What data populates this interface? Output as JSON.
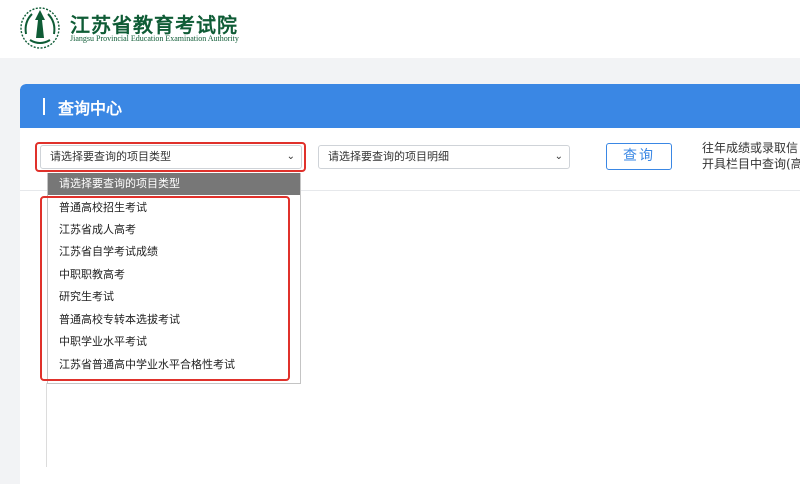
{
  "header": {
    "org_cn": "江苏省教育考试院",
    "org_en": "Jiangsu Provincial Education Examination Authority"
  },
  "panel": {
    "title": "查询中心"
  },
  "form": {
    "type_select": {
      "value": "请选择要查询的项目类型"
    },
    "detail_select": {
      "value": "请选择要查询的项目明细"
    },
    "query_label": "查询"
  },
  "note": {
    "line1": "往年成绩或录取信",
    "line2": "开具栏目中查询(高"
  },
  "dropdown": {
    "options": [
      "请选择要查询的项目类型",
      "普通高校招生考试",
      "江苏省成人高考",
      "江苏省自学考试成绩",
      "中职职教高考",
      "研究生考试",
      "普通高校专转本选拔考试",
      "中职学业水平考试",
      "江苏省普通高中学业水平合格性考试"
    ],
    "selected_index": 0
  },
  "colors": {
    "brand_green": "#0f5c36",
    "header_blue": "#3a87e4",
    "highlight_red": "#e0312b",
    "selected_gray": "#777777"
  }
}
